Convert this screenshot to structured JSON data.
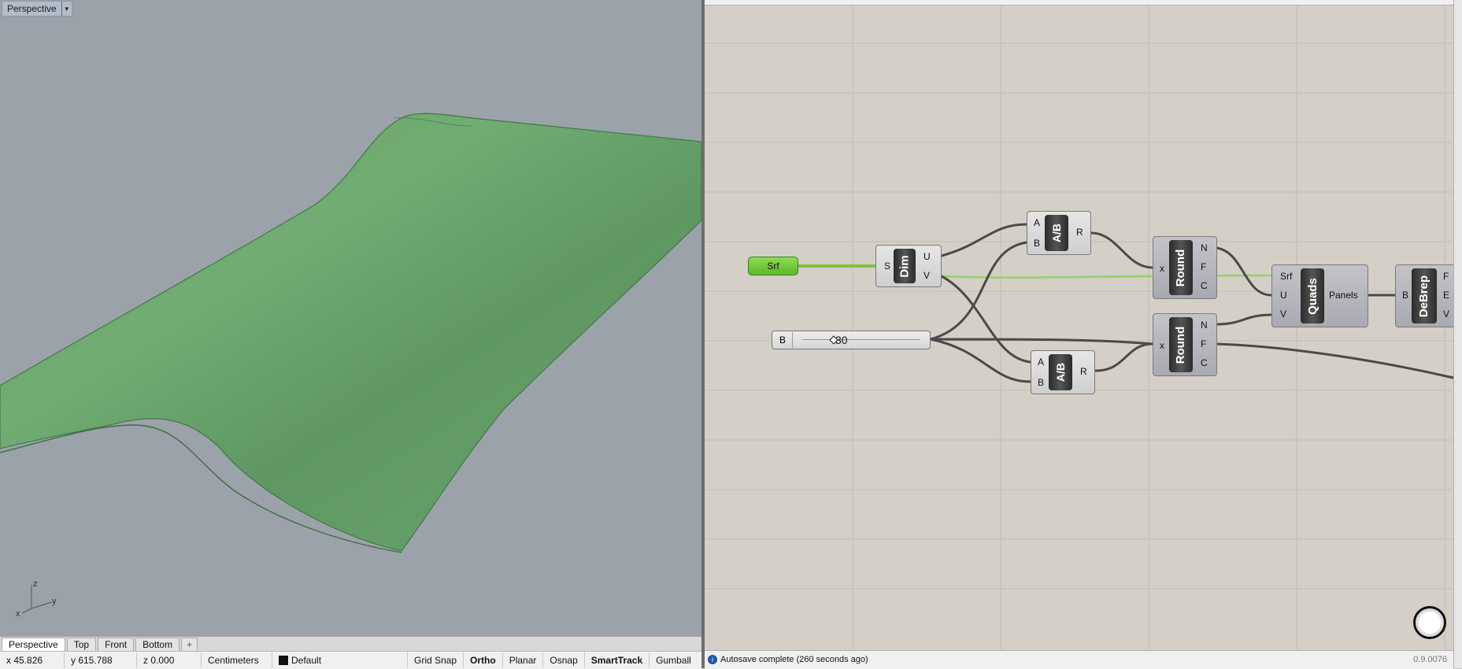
{
  "viewport": {
    "title": "Perspective",
    "dropdown_glyph": "▾",
    "axis_labels": {
      "z": "z",
      "y": "y",
      "x": "x"
    },
    "surface_color": "#6aa56e"
  },
  "viewport_tabs": [
    {
      "label": "Perspective",
      "active": true
    },
    {
      "label": "Top"
    },
    {
      "label": "Front"
    },
    {
      "label": "Bottom"
    },
    {
      "label": "+"
    }
  ],
  "statusbar": {
    "x": "x 45.826",
    "y": "y 615.788",
    "z": "z 0.000",
    "units": "Centimeters",
    "layer": "Default",
    "toggles": [
      "Grid Snap",
      "Ortho",
      "Planar",
      "Osnap",
      "SmartTrack",
      "Gumball"
    ]
  },
  "grasshopper": {
    "srf": {
      "label": "Srf"
    },
    "dim": {
      "name": "Dim",
      "inputs": [
        "S"
      ],
      "outputs": [
        "U",
        "V"
      ]
    },
    "div_top": {
      "name": "A/B",
      "inputs": [
        "A",
        "B"
      ],
      "outputs": [
        "R"
      ]
    },
    "div_bottom": {
      "name": "A/B",
      "inputs": [
        "A",
        "B"
      ],
      "outputs": [
        "R"
      ]
    },
    "slider": {
      "name": "B",
      "value": "30"
    },
    "round_top": {
      "name": "Round",
      "inputs": [
        "x"
      ],
      "outputs": [
        "N",
        "F",
        "C"
      ]
    },
    "round_bottom": {
      "name": "Round",
      "inputs": [
        "x"
      ],
      "outputs": [
        "N",
        "F",
        "C"
      ]
    },
    "quads": {
      "name": "Quads",
      "inputs": [
        "Srf",
        "U",
        "V"
      ],
      "outputs": [
        "Panels"
      ]
    },
    "debrep": {
      "name": "DeBrep",
      "inputs": [
        "B"
      ],
      "outputs": [
        "F",
        "E",
        "V"
      ]
    },
    "status_message": "Autosave complete (260 seconds ago)",
    "info_glyph": "i",
    "version": "0.9.0076",
    "canvas_color": "#d4d0c8",
    "wire_color": "#4a4a4a",
    "selected_wire_color": "#7fc241"
  }
}
